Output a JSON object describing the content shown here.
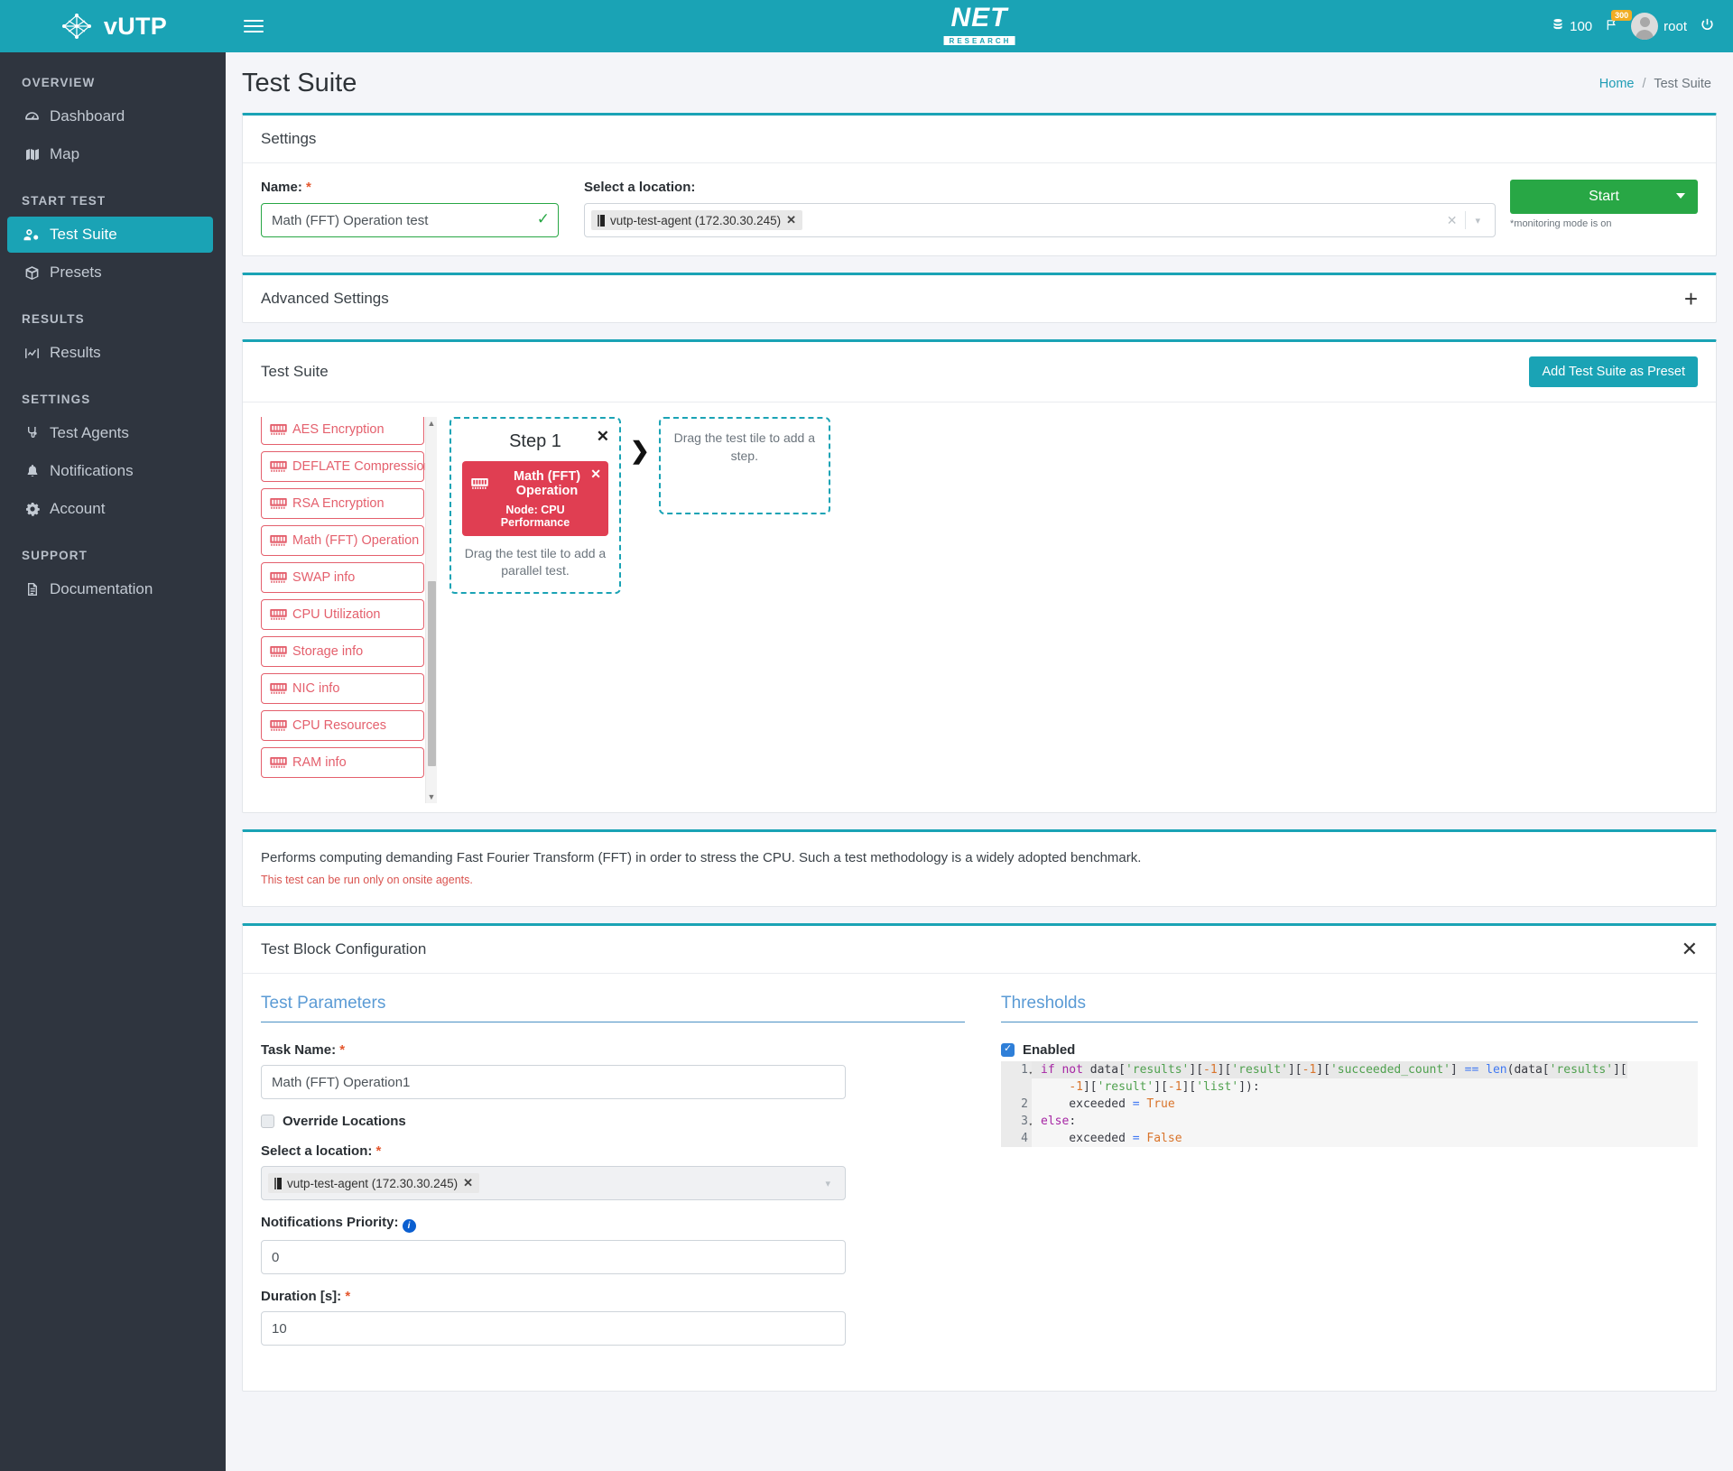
{
  "brand": {
    "name": "vUTP",
    "logo_icon": "network-node-icon"
  },
  "sidebar": {
    "sections": [
      {
        "label": "OVERVIEW",
        "items": [
          {
            "label": "Dashboard",
            "icon": "dashboard-icon",
            "active": false
          },
          {
            "label": "Map",
            "icon": "map-icon",
            "active": false
          }
        ]
      },
      {
        "label": "START TEST",
        "items": [
          {
            "label": "Test Suite",
            "icon": "test-suite-icon",
            "active": true
          },
          {
            "label": "Presets",
            "icon": "box-icon",
            "active": false
          }
        ]
      },
      {
        "label": "RESULTS",
        "items": [
          {
            "label": "Results",
            "icon": "chart-icon",
            "active": false
          }
        ]
      },
      {
        "label": "SETTINGS",
        "items": [
          {
            "label": "Test Agents",
            "icon": "agents-icon",
            "active": false
          },
          {
            "label": "Notifications",
            "icon": "bell-icon",
            "active": false
          },
          {
            "label": "Account",
            "icon": "gear-icon",
            "active": false
          }
        ]
      },
      {
        "label": "SUPPORT",
        "items": [
          {
            "label": "Documentation",
            "icon": "document-icon",
            "active": false
          }
        ]
      }
    ]
  },
  "topbar": {
    "menu_icon": "hamburger-icon",
    "logo_main": "NET",
    "logo_sub": "RESEARCH",
    "credits": "100",
    "credits_icon": "database-icon",
    "flag_icon": "flag-icon",
    "flag_badge": "300",
    "user": "root",
    "logout_icon": "power-icon"
  },
  "page": {
    "title": "Test Suite",
    "breadcrumb": {
      "home": "Home",
      "separator": "/",
      "current": "Test Suite"
    }
  },
  "settings": {
    "card_title": "Settings",
    "name_label": "Name:",
    "name_value": "Math (FFT) Operation test",
    "name_valid_icon": "check-icon",
    "location_label": "Select a location:",
    "location_chip": "vutp-test-agent (172.30.30.245)",
    "location_chip_icon": "server-icon",
    "clear_icon": "clear-x-icon",
    "dropdown_icon": "chevron-down-icon",
    "start_label": "Start",
    "start_caret_icon": "caret-down-icon",
    "monitoring_note": "*monitoring mode is on"
  },
  "advanced": {
    "title": "Advanced Settings",
    "expand_icon": "plus-icon"
  },
  "suite": {
    "title": "Test Suite",
    "preset_button": "Add Test Suite as Preset",
    "tiles": [
      {
        "label": "AES Encryption",
        "icon": "ram-chip-icon"
      },
      {
        "label": "DEFLATE Compression",
        "icon": "ram-chip-icon"
      },
      {
        "label": "RSA Encryption",
        "icon": "ram-chip-icon"
      },
      {
        "label": "Math (FFT) Operation",
        "icon": "ram-chip-icon"
      },
      {
        "label": "SWAP info",
        "icon": "ram-chip-icon"
      },
      {
        "label": "CPU Utilization",
        "icon": "ram-chip-icon"
      },
      {
        "label": "Storage info",
        "icon": "ram-chip-icon"
      },
      {
        "label": "NIC info",
        "icon": "ram-chip-icon"
      },
      {
        "label": "CPU Resources",
        "icon": "ram-chip-icon"
      },
      {
        "label": "RAM info",
        "icon": "ram-chip-icon"
      }
    ],
    "scroll_up_icon": "triangle-up-icon",
    "scroll_down_icon": "triangle-down-icon",
    "step": {
      "title": "Step 1",
      "close_icon": "close-icon",
      "test": {
        "name": "Math (FFT) Operation",
        "node": "Node: CPU Performance",
        "icon": "ram-chip-icon",
        "remove_icon": "close-icon"
      },
      "parallel_hint": "Drag the test tile to add a parallel test."
    },
    "arrow_icon": "chevron-right-icon",
    "dropzone_hint": "Drag the test tile to add a step."
  },
  "description": {
    "text": "Performs computing demanding Fast Fourier Transform (FFT) in order to stress the CPU. Such a test methodology is a widely adopted benchmark.",
    "warning": "This test can be run only on onsite agents."
  },
  "block_config": {
    "title": "Test Block Configuration",
    "close_icon": "close-icon",
    "parameters": {
      "section_title": "Test Parameters",
      "task_name_label": "Task Name:",
      "task_name_value": "Math (FFT) Operation1",
      "override_locations_label": "Override Locations",
      "override_locations_checked": false,
      "location_label": "Select a location:",
      "location_chip": "vutp-test-agent (172.30.30.245)",
      "location_chip_icon": "server-icon",
      "dropdown_icon": "chevron-down-icon",
      "priority_label": "Notifications Priority:",
      "priority_info_icon": "info-icon",
      "priority_value": "0",
      "duration_label": "Duration [s]:",
      "duration_value": "10"
    },
    "thresholds": {
      "section_title": "Thresholds",
      "enabled_label": "Enabled",
      "enabled_checked": true,
      "code_lines": [
        {
          "num": "1",
          "fold": true,
          "highlight": true,
          "tokens": [
            {
              "t": "if ",
              "c": "k-kw"
            },
            {
              "t": "not ",
              "c": "k-kw"
            },
            {
              "t": "data[",
              "c": "k-plain"
            },
            {
              "t": "'results'",
              "c": "k-str"
            },
            {
              "t": "][",
              "c": "k-plain"
            },
            {
              "t": "-1",
              "c": "k-num"
            },
            {
              "t": "][",
              "c": "k-plain"
            },
            {
              "t": "'result'",
              "c": "k-str"
            },
            {
              "t": "][",
              "c": "k-plain"
            },
            {
              "t": "-1",
              "c": "k-num"
            },
            {
              "t": "][",
              "c": "k-plain"
            },
            {
              "t": "'succeeded_count'",
              "c": "k-str"
            },
            {
              "t": "] ",
              "c": "k-plain"
            },
            {
              "t": "== ",
              "c": "k-op"
            },
            {
              "t": "len",
              "c": "k-fn"
            },
            {
              "t": "(data[",
              "c": "k-plain"
            },
            {
              "t": "'results'",
              "c": "k-str"
            },
            {
              "t": "][",
              "c": "k-plain"
            }
          ]
        },
        {
          "num": "",
          "fold": false,
          "highlight": false,
          "tokens": [
            {
              "t": "    ",
              "c": "k-plain"
            },
            {
              "t": "-1",
              "c": "k-num"
            },
            {
              "t": "][",
              "c": "k-plain"
            },
            {
              "t": "'result'",
              "c": "k-str"
            },
            {
              "t": "][",
              "c": "k-plain"
            },
            {
              "t": "-1",
              "c": "k-num"
            },
            {
              "t": "][",
              "c": "k-plain"
            },
            {
              "t": "'list'",
              "c": "k-str"
            },
            {
              "t": "]):",
              "c": "k-plain"
            }
          ]
        },
        {
          "num": "2",
          "fold": false,
          "highlight": false,
          "tokens": [
            {
              "t": "    exceeded ",
              "c": "k-plain"
            },
            {
              "t": "= ",
              "c": "k-op"
            },
            {
              "t": "True",
              "c": "k-num"
            }
          ]
        },
        {
          "num": "3",
          "fold": true,
          "highlight": false,
          "tokens": [
            {
              "t": "else",
              "c": "k-kw"
            },
            {
              "t": ":",
              "c": "k-plain"
            }
          ]
        },
        {
          "num": "4",
          "fold": false,
          "highlight": false,
          "tokens": [
            {
              "t": "    exceeded ",
              "c": "k-plain"
            },
            {
              "t": "= ",
              "c": "k-op"
            },
            {
              "t": "False",
              "c": "k-num"
            }
          ]
        }
      ]
    }
  },
  "colors": {
    "brand_teal": "#1aa3b5",
    "sidebar_dark": "#2f353f",
    "start_green": "#28a745",
    "test_red": "#e03e52",
    "tile_red": "#e4606d",
    "badge_orange": "#f0ad24"
  }
}
